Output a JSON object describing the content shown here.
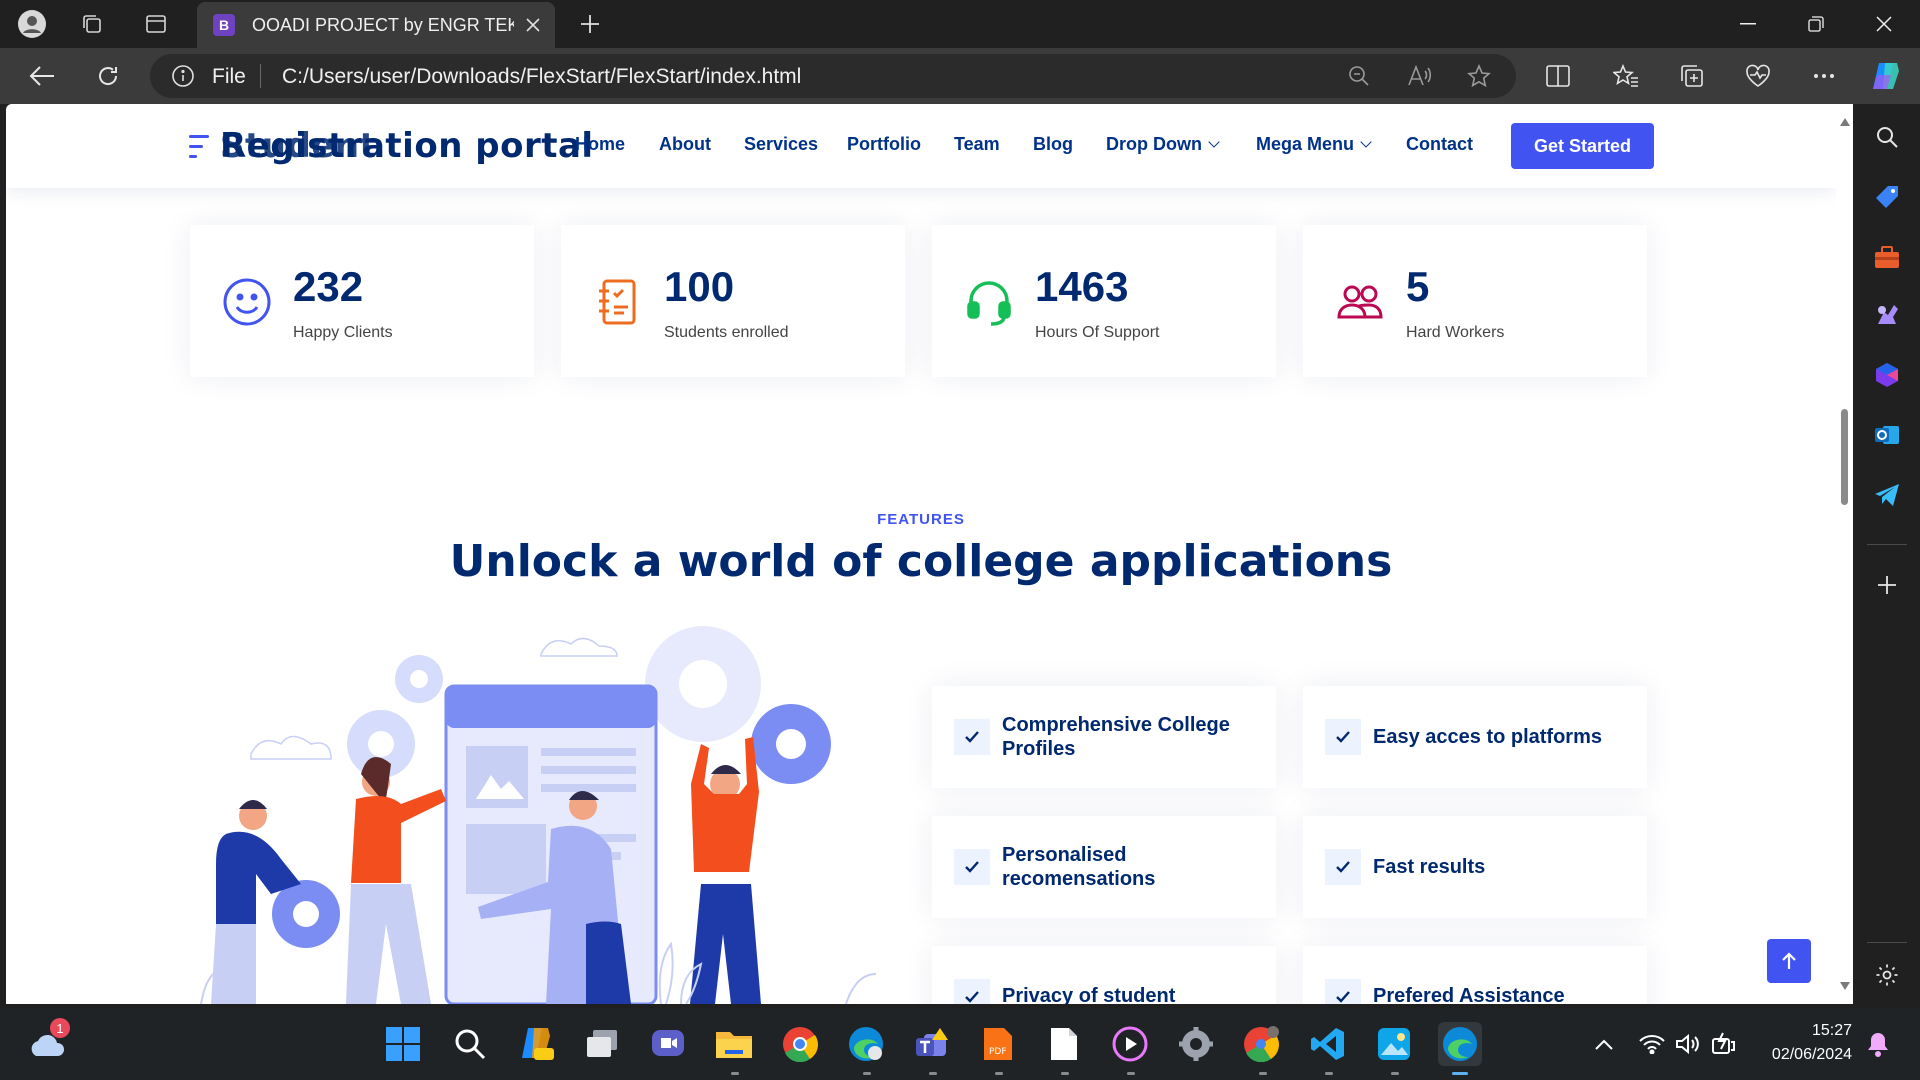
{
  "browser": {
    "tab_title": "OOADI PROJECT by ENGR TEKO",
    "tab_favicon": "B",
    "address_scheme": "File",
    "address_url": "C:/Users/user/Downloads/FlexStart/FlexStart/index.html"
  },
  "site": {
    "logo_overlap_a": "Registration portal",
    "logo_overlap_b": "Student",
    "nav": {
      "home": "Home",
      "about": "About",
      "services": "Services",
      "portfolio": "Portfolio",
      "team": "Team",
      "blog": "Blog",
      "dropdown": "Drop Down",
      "mega": "Mega Menu",
      "contact": "Contact",
      "cta": "Get Started"
    },
    "stats": [
      {
        "value": "232",
        "label": "Happy Clients",
        "icon": "smile-icon",
        "color": "#4154f1"
      },
      {
        "value": "100",
        "label": "Students enrolled",
        "icon": "journal-icon",
        "color": "#ee6c20"
      },
      {
        "value": "1463",
        "label": "Hours Of Support",
        "icon": "headset-icon",
        "color": "#15be56"
      },
      {
        "value": "5",
        "label": "Hard Workers",
        "icon": "people-icon",
        "color": "#bb0852"
      }
    ],
    "features": {
      "tag": "FEATURES",
      "title": "Unlock a world of college applications",
      "items": [
        {
          "label": "Comprehensive College Profiles"
        },
        {
          "label": "Easy acces to platforms"
        },
        {
          "label": "Personalised recomensations"
        },
        {
          "label": "Fast results"
        },
        {
          "label": "Privacy of student"
        },
        {
          "label": "Prefered Assistance"
        }
      ]
    }
  },
  "taskbar": {
    "weather_badge": "1",
    "time": "15:27",
    "date": "02/06/2024"
  },
  "colors": {
    "accent": "#4154f1",
    "heading": "#012970"
  }
}
